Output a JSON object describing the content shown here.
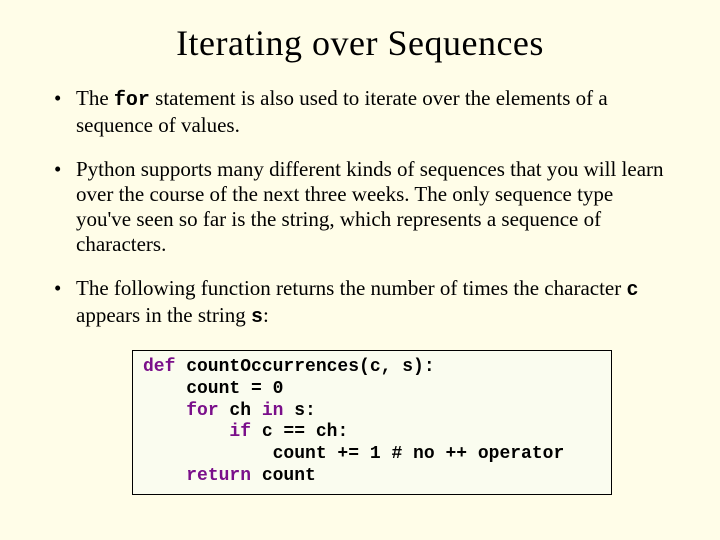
{
  "title": "Iterating over Sequences",
  "bullets": {
    "b1a": "The ",
    "b1_for": "for",
    "b1b": " statement is also used to iterate over the elements of a sequence of values.",
    "b2": "Python supports many different kinds of sequences that you will learn over the course of the next three weeks.  The only sequence type you've seen so far is the string, which represents a sequence of characters.",
    "b3a": "The following function returns the number of times the character ",
    "b3_c": "c",
    "b3b": " appears in the string ",
    "b3_s": "s",
    "b3c": ":"
  },
  "code": {
    "kw_def": "def",
    "l1_rest": " countOccurrences(c, s):",
    "l2": "    count = 0",
    "l3_indent": "    ",
    "kw_for": "for",
    "l3_mid": " ch ",
    "kw_in": "in",
    "l3_end": " s:",
    "l4_indent": "        ",
    "kw_if": "if",
    "l4_end": " c == ch:",
    "l5": "            count += 1 # no ++ operator",
    "l6_indent": "    ",
    "kw_return": "return",
    "l6_end": " count"
  }
}
